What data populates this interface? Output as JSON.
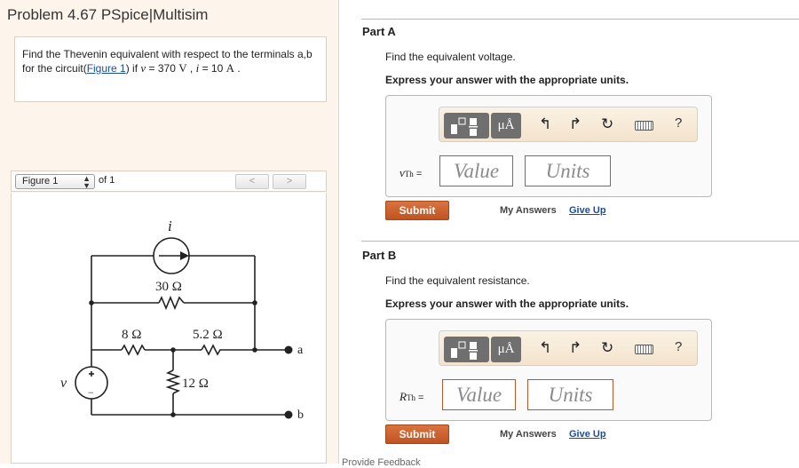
{
  "header": {
    "title": "Problem 4.67 PSpice|Multisim"
  },
  "problem": {
    "text_before": "Find the Thevenin equivalent with respect to the terminals a,b for the circuit(",
    "figure_link": "Figure 1",
    "text_middle": ") if ",
    "v_sym": "v",
    "eq1": " = 370 ",
    "v_unit": "V",
    "sep": " , ",
    "i_sym": "i",
    "eq2": " = 10 ",
    "i_unit": "A",
    "end": " ."
  },
  "figure_nav": {
    "select_label": "Figure 1",
    "of_label": "of 1",
    "prev": "<",
    "next": ">"
  },
  "circuit": {
    "current_label": "i",
    "r1": "30 Ω",
    "r2": "8 Ω",
    "r3": "5.2 Ω",
    "r4": "12 Ω",
    "terminal_a": "a",
    "terminal_b": "b",
    "source_label": "v",
    "plus": "+",
    "minus": "−"
  },
  "partA": {
    "title": "Part A",
    "prompt": "Find the equivalent voltage.",
    "instruction": "Express your answer with the appropriate units.",
    "var_symbol": "v",
    "var_sub": "Th",
    "equals": " =",
    "value_placeholder": "Value",
    "units_placeholder": "Units",
    "submit_label": "Submit",
    "my_answers_label": "My Answers",
    "give_up_label": "Give Up"
  },
  "partB": {
    "title": "Part B",
    "prompt": "Find the equivalent resistance.",
    "instruction": "Express your answer with the appropriate units.",
    "var_symbol": "R",
    "var_sub": "Th",
    "equals": " =",
    "value_placeholder": "Value",
    "units_placeholder": "Units",
    "submit_label": "Submit",
    "my_answers_label": "My Answers",
    "give_up_label": "Give Up"
  },
  "toolbar": {
    "units_button": "μÅ",
    "undo_icon": "undo-icon",
    "redo_icon": "redo-icon",
    "reset_icon": "reset-icon",
    "keyboard_icon": "keyboard-icon",
    "help_label": "?"
  },
  "footer": {
    "hint": "Provide Feedback"
  },
  "colors": {
    "accent": "#c65a28",
    "link": "#1a4e9c",
    "left_bg": "#fdf4ec"
  }
}
